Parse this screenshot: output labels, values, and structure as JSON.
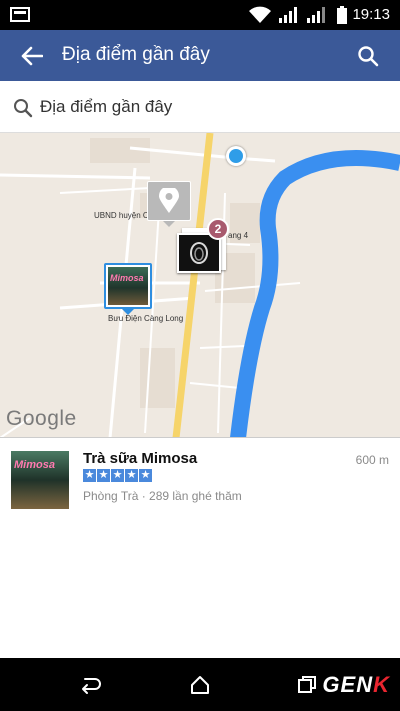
{
  "status_bar": {
    "time": "19:13",
    "icons": [
      "notification-icon",
      "wifi-icon",
      "signal-icon",
      "signal-2-icon",
      "battery-icon"
    ]
  },
  "app_bar": {
    "title": "Địa điểm gần đây",
    "back_icon": "arrow-left-icon",
    "search_icon": "search-icon",
    "color": "#3b5998"
  },
  "search": {
    "placeholder": "Địa điểm gần đây"
  },
  "map": {
    "labels": {
      "ubnd": "UBND huyện C",
      "street_4": "ang 4",
      "post_office": "Bưu Điện Càng Long"
    },
    "cluster_count": "2",
    "logo": "Google",
    "place_thumb_text": "Mimosa"
  },
  "places": [
    {
      "name": "Trà sữa Mimosa",
      "rating": 5,
      "meta": "Phòng Trà · 289 lần ghé thăm",
      "distance": "600 m",
      "thumb_text": "Mimosa"
    }
  ],
  "nav_bar": {
    "brand_prefix": "GEN",
    "brand_suffix": "K"
  },
  "colors": {
    "accent": "#3b5998",
    "star": "#4a89dc",
    "river": "#3a8ff0",
    "main_road": "#f6d46a",
    "badge": "#a85a6e",
    "location_dot": "#2f9de8"
  }
}
